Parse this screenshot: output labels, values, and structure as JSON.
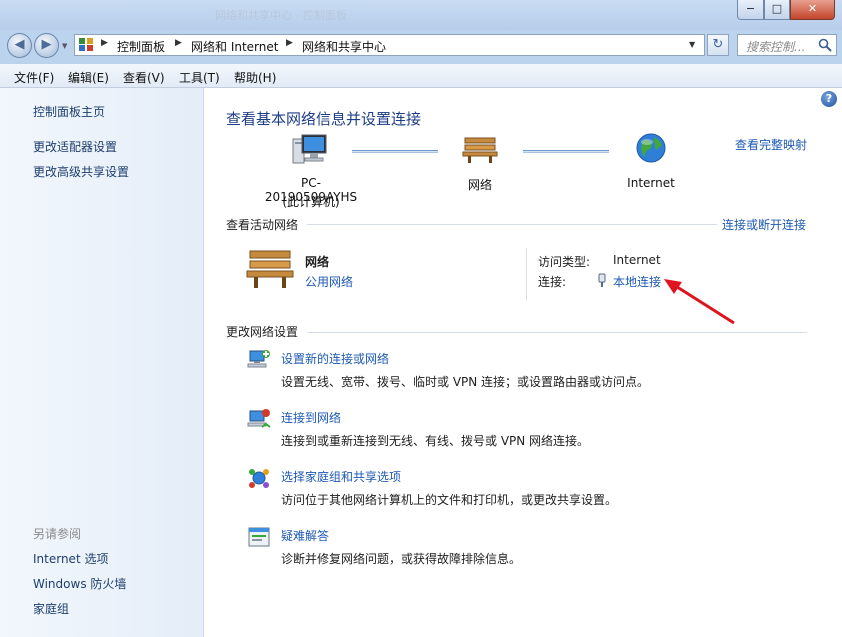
{
  "window": {
    "title": "网络和共享中心 - 控制面板",
    "minimize_label": "−",
    "maximize_label": "□",
    "close_label": "✕"
  },
  "nav": {
    "back_glyph": "◀",
    "forward_glyph": "▶",
    "breadcrumbs": [
      "控制面板",
      "网络和 Internet",
      "网络和共享中心"
    ],
    "crumb_separator": "▶",
    "refresh_glyph": "↻",
    "search_placeholder": "搜索控制..."
  },
  "menu": [
    "文件(F)",
    "编辑(E)",
    "查看(V)",
    "工具(T)",
    "帮助(H)"
  ],
  "left_pane": {
    "links": [
      "控制面板主页",
      "更改适配器设置",
      "更改高级共享设置"
    ],
    "see_also_label": "另请参阅",
    "see_also_links": [
      "Internet 选项",
      "Windows 防火墙",
      "家庭组"
    ]
  },
  "main": {
    "help_glyph": "?",
    "title": "查看基本网络信息并设置连接",
    "view_full_map": "查看完整映射",
    "map": {
      "computer_name": "PC-20190509AYHS",
      "computer_sub": "(此计算机)",
      "network_label": "网络",
      "internet_label": "Internet"
    },
    "active_networks": {
      "header": "查看活动网络",
      "action": "连接或断开连接",
      "network_name": "网络",
      "network_type": "公用网络",
      "access_type_label": "访问类型:",
      "access_type_value": "Internet",
      "connections_label": "连接:",
      "connections_value": "本地连接"
    },
    "change_settings": {
      "header": "更改网络设置",
      "tasks": [
        {
          "title": "设置新的连接或网络",
          "desc": "设置无线、宽带、拨号、临时或 VPN 连接；或设置路由器或访问点。",
          "icon": "new-connection-icon"
        },
        {
          "title": "连接到网络",
          "desc": "连接到或重新连接到无线、有线、拨号或 VPN 网络连接。",
          "icon": "connect-network-icon"
        },
        {
          "title": "选择家庭组和共享选项",
          "desc": "访问位于其他网络计算机上的文件和打印机，或更改共享设置。",
          "icon": "homegroup-icon"
        },
        {
          "title": "疑难解答",
          "desc": "诊断并修复网络问题，或获得故障排除信息。",
          "icon": "troubleshoot-icon"
        }
      ]
    }
  },
  "colors": {
    "link": "#1e5ab4",
    "title": "#1e3d87",
    "annotation_arrow": "#e0141e"
  }
}
